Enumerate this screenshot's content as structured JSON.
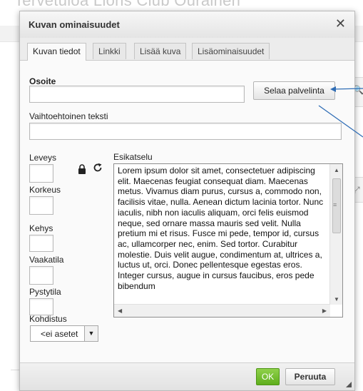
{
  "background": {
    "page_title": "Tervetuloa Lions Club Ourainen"
  },
  "dialog": {
    "title": "Kuvan ominaisuudet",
    "close_glyph": "✕",
    "tabs": [
      {
        "label": "Kuvan tiedot",
        "active": true
      },
      {
        "label": "Linkki",
        "active": false
      },
      {
        "label": "Lisää kuva",
        "active": false
      },
      {
        "label": "Lisäominaisuudet",
        "active": false
      }
    ],
    "fields": {
      "address_label": "Osoite",
      "address_value": "",
      "browse_button": "Selaa palvelinta",
      "alt_label": "Vaihtoehtoinen teksti",
      "alt_value": "",
      "width_label": "Leveys",
      "height_label": "Korkeus",
      "border_label": "Kehys",
      "hspace_label": "Vaakatila",
      "vspace_label": "Pystytila",
      "align_label": "Kohdistus",
      "align_value": "<ei asetet"
    },
    "preview": {
      "label": "Esikatselu",
      "text": "Lorem ipsum dolor sit amet, consectetuer adipiscing elit. Maecenas feugiat consequat diam. Maecenas metus. Vivamus diam purus, cursus a, commodo non, facilisis vitae, nulla. Aenean dictum lacinia tortor. Nunc iaculis, nibh non iaculis aliquam, orci felis euismod neque, sed ornare massa mauris sed velit. Nulla pretium mi et risus. Fusce mi pede, tempor id, cursus ac, ullamcorper nec, enim. Sed tortor. Curabitur molestie. Duis velit augue, condimentum at, ultrices a, luctus ut, orci. Donec pellentesque egestas eros. Integer cursus, augue in cursus faucibus, eros pede bibendum"
    },
    "buttons": {
      "ok": "OK",
      "cancel": "Peruuta"
    }
  },
  "colors": {
    "ok_green": "#6ab82a",
    "annotation_blue": "#2f6db5"
  }
}
